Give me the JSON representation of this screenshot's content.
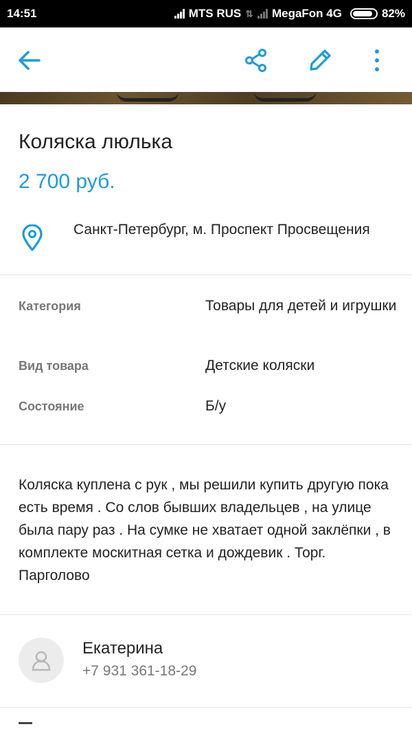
{
  "status_bar": {
    "time": "14:51",
    "carrier1": "MTS RUS",
    "carrier2": "MegaFon 4G",
    "battery": "82%"
  },
  "toolbar": {
    "back_icon": "arrow-left-icon",
    "share_icon": "share-icon",
    "edit_icon": "pencil-icon",
    "more_icon": "more-vertical-icon",
    "accent_color": "#1a9be0"
  },
  "listing": {
    "title": "Коляска люлька",
    "price": "2 700 руб.",
    "location": "Санкт-Петербург, м. Проспект Просвещения"
  },
  "attributes": [
    {
      "label": "Категория",
      "value": "Товары для детей и игрушки"
    },
    {
      "label": "Вид товара",
      "value": "Детские коляски"
    },
    {
      "label": "Состояние",
      "value": "Б/у"
    }
  ],
  "description": "Коляска куплена с рук , мы решили купить другую пока есть время  . Со слов бывших владельцев , на улице была пару раз . На сумке не хватает одной заклёпки , в комплекте москитная сетка и дождевик . Торг. Парголово",
  "seller": {
    "name": "Екатерина",
    "phone": "+7 931 361-18-29",
    "avatar_icon": "user-icon"
  }
}
